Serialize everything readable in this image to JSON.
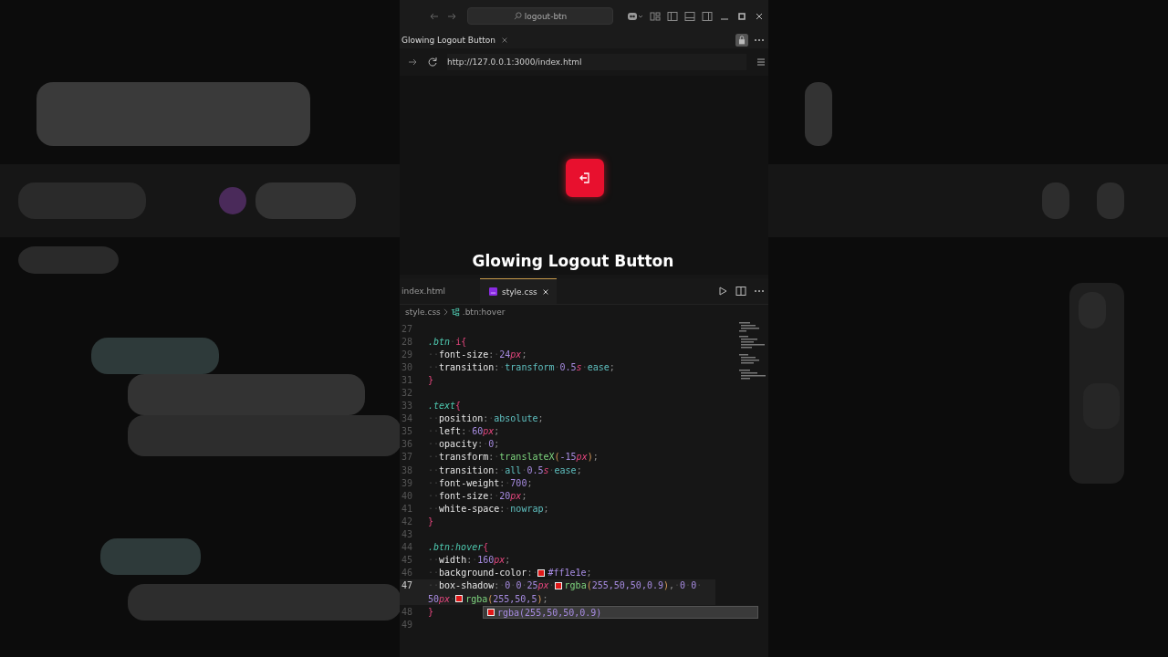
{
  "window": {
    "search": "logout-btn"
  },
  "browser": {
    "tab": {
      "title": "Glowing Logout Button",
      "selected": true
    },
    "url": "http://127.0.0.1:3000/index.html"
  },
  "preview": {
    "caption": "Glowing Logout Button"
  },
  "editor": {
    "tabs": [
      {
        "label": "index.html",
        "selected": false
      },
      {
        "label": "style.css",
        "selected": true
      }
    ],
    "breadcrumb": {
      "file": "style.css",
      "symbol": ".btn:hover"
    },
    "lines": [
      {
        "number": "27",
        "current": false
      },
      {
        "number": "28",
        "current": false,
        "tokens": [
          {
            "text": ".btn",
            "kind": "sel"
          },
          {
            "text": "·",
            "kind": "ws"
          },
          {
            "text": "i",
            "kind": "tag"
          },
          {
            "text": "{",
            "kind": "brace"
          }
        ]
      },
      {
        "number": "29",
        "current": false,
        "tokens": [
          {
            "text": "··",
            "kind": "ws"
          },
          {
            "text": "font-size",
            "kind": "prop"
          },
          {
            "text": ":",
            "kind": "punct"
          },
          {
            "text": "·",
            "kind": "ws"
          },
          {
            "text": "24",
            "kind": "num"
          },
          {
            "text": "px",
            "kind": "unit"
          },
          {
            "text": ";",
            "kind": "punct"
          }
        ]
      },
      {
        "number": "30",
        "current": false,
        "tokens": [
          {
            "text": "··",
            "kind": "ws"
          },
          {
            "text": "transition",
            "kind": "prop"
          },
          {
            "text": ":",
            "kind": "punct"
          },
          {
            "text": "·",
            "kind": "ws"
          },
          {
            "text": "transform",
            "kind": "val"
          },
          {
            "text": "·",
            "kind": "ws"
          },
          {
            "text": "0.5",
            "kind": "num"
          },
          {
            "text": "s",
            "kind": "unit"
          },
          {
            "text": "·",
            "kind": "ws"
          },
          {
            "text": "ease",
            "kind": "val"
          },
          {
            "text": ";",
            "kind": "punct"
          }
        ]
      },
      {
        "number": "31",
        "current": false,
        "tokens": [
          {
            "text": "}",
            "kind": "brace"
          }
        ]
      },
      {
        "number": "32",
        "current": false
      },
      {
        "number": "33",
        "current": false,
        "tokens": [
          {
            "text": ".text",
            "kind": "sel"
          },
          {
            "text": "{",
            "kind": "brace"
          }
        ]
      },
      {
        "number": "34",
        "current": false,
        "tokens": [
          {
            "text": "··",
            "kind": "ws"
          },
          {
            "text": "position",
            "kind": "prop"
          },
          {
            "text": ":",
            "kind": "punct"
          },
          {
            "text": "·",
            "kind": "ws"
          },
          {
            "text": "absolute",
            "kind": "val"
          },
          {
            "text": ";",
            "kind": "punct"
          }
        ]
      },
      {
        "number": "35",
        "current": false,
        "tokens": [
          {
            "text": "··",
            "kind": "ws"
          },
          {
            "text": "left",
            "kind": "prop"
          },
          {
            "text": ":",
            "kind": "punct"
          },
          {
            "text": "·",
            "kind": "ws"
          },
          {
            "text": "60",
            "kind": "num"
          },
          {
            "text": "px",
            "kind": "unit"
          },
          {
            "text": ";",
            "kind": "punct"
          }
        ]
      },
      {
        "number": "36",
        "current": false,
        "tokens": [
          {
            "text": "··",
            "kind": "ws"
          },
          {
            "text": "opacity",
            "kind": "prop"
          },
          {
            "text": ":",
            "kind": "punct"
          },
          {
            "text": "·",
            "kind": "ws"
          },
          {
            "text": "0",
            "kind": "num"
          },
          {
            "text": ";",
            "kind": "punct"
          }
        ]
      },
      {
        "number": "37",
        "current": false,
        "tokens": [
          {
            "text": "··",
            "kind": "ws"
          },
          {
            "text": "transform",
            "kind": "prop"
          },
          {
            "text": ":",
            "kind": "punct"
          },
          {
            "text": "·",
            "kind": "ws"
          },
          {
            "text": "translateX",
            "kind": "fn"
          },
          {
            "text": "(",
            "kind": "paren"
          },
          {
            "text": "-15",
            "kind": "num"
          },
          {
            "text": "px",
            "kind": "unit"
          },
          {
            "text": ")",
            "kind": "paren"
          },
          {
            "text": ";",
            "kind": "punct"
          }
        ]
      },
      {
        "number": "38",
        "current": false,
        "tokens": [
          {
            "text": "··",
            "kind": "ws"
          },
          {
            "text": "transition",
            "kind": "prop"
          },
          {
            "text": ":",
            "kind": "punct"
          },
          {
            "text": "·",
            "kind": "ws"
          },
          {
            "text": "all",
            "kind": "val"
          },
          {
            "text": "·",
            "kind": "ws"
          },
          {
            "text": "0.5",
            "kind": "num"
          },
          {
            "text": "s",
            "kind": "unit"
          },
          {
            "text": "·",
            "kind": "ws"
          },
          {
            "text": "ease",
            "kind": "val"
          },
          {
            "text": ";",
            "kind": "punct"
          }
        ]
      },
      {
        "number": "39",
        "current": false,
        "tokens": [
          {
            "text": "··",
            "kind": "ws"
          },
          {
            "text": "font-weight",
            "kind": "prop"
          },
          {
            "text": ":",
            "kind": "punct"
          },
          {
            "text": "·",
            "kind": "ws"
          },
          {
            "text": "700",
            "kind": "num"
          },
          {
            "text": ";",
            "kind": "punct"
          }
        ]
      },
      {
        "number": "40",
        "current": false,
        "tokens": [
          {
            "text": "··",
            "kind": "ws"
          },
          {
            "text": "font-size",
            "kind": "prop"
          },
          {
            "text": ":",
            "kind": "punct"
          },
          {
            "text": "·",
            "kind": "ws"
          },
          {
            "text": "20",
            "kind": "num"
          },
          {
            "text": "px",
            "kind": "unit"
          },
          {
            "text": ";",
            "kind": "punct"
          }
        ]
      },
      {
        "number": "41",
        "current": false,
        "tokens": [
          {
            "text": "··",
            "kind": "ws"
          },
          {
            "text": "white-space",
            "kind": "prop"
          },
          {
            "text": ":",
            "kind": "punct"
          },
          {
            "text": "·",
            "kind": "ws"
          },
          {
            "text": "nowrap",
            "kind": "val"
          },
          {
            "text": ";",
            "kind": "punct"
          }
        ]
      },
      {
        "number": "42",
        "current": false,
        "tokens": [
          {
            "text": "}",
            "kind": "brace"
          }
        ]
      },
      {
        "number": "43",
        "current": false
      },
      {
        "number": "44",
        "current": false,
        "tokens": [
          {
            "text": ".btn:hover",
            "kind": "sel"
          },
          {
            "text": "{",
            "kind": "brace"
          }
        ]
      },
      {
        "number": "45",
        "current": false,
        "tokens": [
          {
            "text": "··",
            "kind": "ws"
          },
          {
            "text": "width",
            "kind": "prop"
          },
          {
            "text": ":",
            "kind": "punct"
          },
          {
            "text": "·",
            "kind": "ws"
          },
          {
            "text": "160",
            "kind": "num"
          },
          {
            "text": "px",
            "kind": "unit"
          },
          {
            "text": ";",
            "kind": "punct"
          }
        ]
      },
      {
        "number": "46",
        "current": false,
        "tokens": [
          {
            "text": "··",
            "kind": "ws"
          },
          {
            "text": "background-color",
            "kind": "prop"
          },
          {
            "text": ":",
            "kind": "punct"
          },
          {
            "text": "·",
            "kind": "ws"
          },
          {
            "kind": "swatch"
          },
          {
            "text": "#ff1e1e",
            "kind": "num"
          },
          {
            "text": ";",
            "kind": "punct"
          }
        ]
      },
      {
        "number": "47",
        "current": true,
        "tokens": [
          {
            "text": "··",
            "kind": "ws"
          },
          {
            "text": "box-shadow",
            "kind": "prop"
          },
          {
            "text": ":",
            "kind": "punct"
          },
          {
            "text": "·",
            "kind": "ws"
          },
          {
            "text": "0",
            "kind": "num"
          },
          {
            "text": "·",
            "kind": "ws"
          },
          {
            "text": "0",
            "kind": "num"
          },
          {
            "text": "·",
            "kind": "ws"
          },
          {
            "text": "25",
            "kind": "num"
          },
          {
            "text": "px",
            "kind": "unit"
          },
          {
            "text": "·",
            "kind": "ws"
          },
          {
            "kind": "swatch"
          },
          {
            "text": "rgba",
            "kind": "fn"
          },
          {
            "text": "(",
            "kind": "paren"
          },
          {
            "text": "255,50,50,0.9",
            "kind": "num"
          },
          {
            "text": ")",
            "kind": "paren"
          },
          {
            "text": ",",
            "kind": "punct"
          },
          {
            "text": "·",
            "kind": "ws"
          },
          {
            "text": "0",
            "kind": "num"
          },
          {
            "text": "·",
            "kind": "ws"
          },
          {
            "text": "0",
            "kind": "num"
          },
          {
            "text": "·",
            "kind": "ws"
          }
        ]
      },
      {
        "current": true,
        "tokens": [
          {
            "text": "50",
            "kind": "num"
          },
          {
            "text": "px",
            "kind": "unit"
          },
          {
            "text": "·",
            "kind": "ws"
          },
          {
            "kind": "swatch"
          },
          {
            "text": "rgba",
            "kind": "fn"
          },
          {
            "text": "(",
            "kind": "paren"
          },
          {
            "text": "255,50,5",
            "kind": "num"
          },
          {
            "text": ")",
            "kind": "paren"
          },
          {
            "text": ";",
            "kind": "punct"
          }
        ]
      },
      {
        "number": "48",
        "current": false,
        "tokens": [
          {
            "text": "}",
            "kind": "brace"
          }
        ]
      },
      {
        "number": "49",
        "current": false
      }
    ],
    "suggestion": {
      "text": "rgba(255,50,50,0.9)"
    }
  }
}
